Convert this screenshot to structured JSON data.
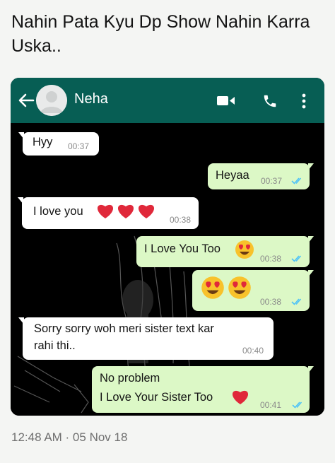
{
  "post": {
    "caption": "Nahin Pata Kyu Dp Show Nahin Karra Uska..",
    "timestamp": "12:48 AM · 05 Nov 18"
  },
  "chat": {
    "contact_name": "Neha",
    "icons": [
      "back-arrow-icon",
      "avatar-placeholder-icon",
      "video-call-icon",
      "phone-call-icon",
      "more-options-icon"
    ],
    "messages": [
      {
        "dir": "in",
        "text": "Hyy",
        "time": "00:37"
      },
      {
        "dir": "out",
        "text": "Heyaa",
        "time": "00:37",
        "status": "read"
      },
      {
        "dir": "in",
        "text": "I love you",
        "emoji": "red-heart-icon ×3",
        "time": "00:38"
      },
      {
        "dir": "out",
        "text": "I Love You Too",
        "emoji": "heart-eyes-icon",
        "time": "00:38",
        "status": "read"
      },
      {
        "dir": "out",
        "text": "",
        "emoji": "heart-eyes-icon ×2",
        "time": "00:38",
        "status": "read"
      },
      {
        "dir": "in",
        "lines": [
          "Sorry sorry woh meri sister text kar",
          "rahi thi.."
        ],
        "time": "00:40"
      },
      {
        "dir": "out",
        "lines": [
          "No problem",
          "I Love Your Sister Too"
        ],
        "emoji": "red-heart-icon",
        "time": "00:41",
        "status": "read"
      }
    ]
  },
  "colors": {
    "header": "#075e54",
    "outgoing_bubble": "#dcf8c6",
    "incoming_bubble": "#ffffff",
    "read_ticks": "#4fc3f7",
    "heart": "#e0283a"
  }
}
